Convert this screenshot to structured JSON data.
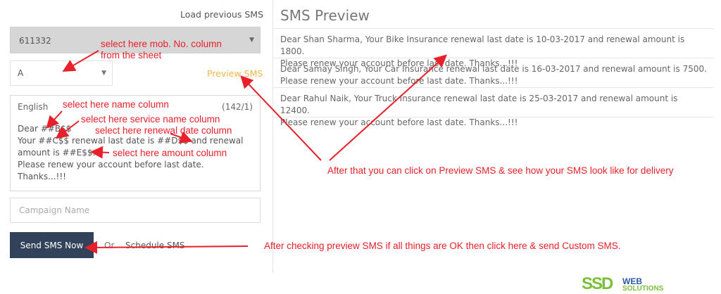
{
  "form": {
    "load_previous": "Load previous SMS",
    "sheet_value": "611332",
    "column_value": "A",
    "preview_link": "Preview SMS",
    "language": "English",
    "char_count": "(142/1)",
    "message_lines": [
      "Dear  ##B$$",
      "Your  ##C$$ renewal last date is  ##D$$ and renewal",
      "amount is  ##E$$.",
      "Please renew your account before last date.",
      "Thanks...!!!"
    ],
    "campaign_placeholder": "Campaign Name",
    "send_label": "Send SMS Now",
    "or_label": "Or",
    "schedule_label": "Schedule SMS"
  },
  "preview": {
    "title": "SMS Preview",
    "items": [
      {
        "line1": "Dear Shan Sharma, Your Bike Insurance renewal last date is 10-03-2017 and renewal amount is 1800.",
        "line2": "Please renew your account before last date. Thanks...!!!"
      },
      {
        "line1": "Dear Samay Singh, Your Car Insurance renewal last date is 16-03-2017 and renewal amount is 7500.",
        "line2": "Please renew your account before last date. Thanks...!!!"
      },
      {
        "line1": "Dear Rahul Naik, Your Truck Insurance renewal last date is 25-03-2017 and renewal amount is 12400.",
        "line2": "Please renew your account before last date. Thanks...!!!"
      }
    ]
  },
  "annotations": {
    "mobile_col_1": "select here mob. No. column",
    "mobile_col_2": "from the sheet",
    "name_col": "select here name column",
    "service_col": "select here service name column",
    "date_col": "select here renewal date column",
    "amount_col": "select here amount column",
    "preview_hint": "After that you can click on Preview SMS & see how your SMS look like for delivery",
    "send_hint": "After checking preview SMS if all things are OK then click here & send Custom SMS."
  },
  "logo": {
    "mark": "SSD",
    "line1": "WEB",
    "line2": "SOLUTIONS"
  },
  "colors": {
    "accent": "#33425b",
    "annotation": "#e8202a",
    "preview_link": "#f0b64a"
  }
}
